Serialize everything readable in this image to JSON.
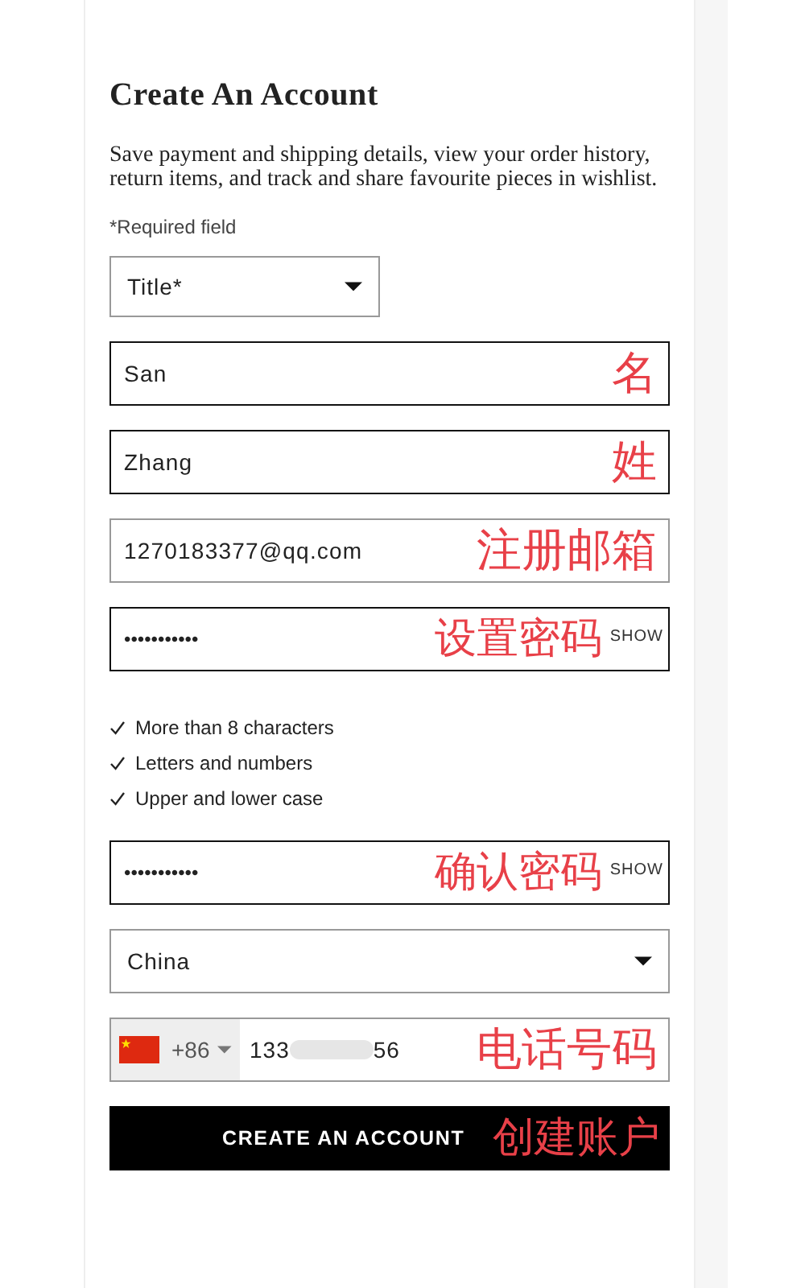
{
  "heading": "Create An Account",
  "intro": "Save payment and shipping details, view your order history, return items, and track and share favourite pieces in wishlist.",
  "required_note": "*Required field",
  "title_select": {
    "value": "Title*"
  },
  "fields": [
    {
      "kind": "text",
      "value": "San",
      "highlighted": true,
      "annotation": "名"
    },
    {
      "kind": "text",
      "value": "Zhang",
      "highlighted": true,
      "annotation": "姓"
    },
    {
      "kind": "text",
      "value": "1270183377@qq.com",
      "highlighted": false,
      "annotation": "注册邮箱"
    },
    {
      "kind": "password",
      "value": "•••••••••••",
      "toggle": "SHOW",
      "highlighted": true,
      "annotation": "设置密码"
    }
  ],
  "password_rules": [
    {
      "text": "More than 8 characters",
      "checked": true
    },
    {
      "text": "Letters and numbers",
      "checked": true
    },
    {
      "text": "Upper and lower case",
      "checked": true
    }
  ],
  "confirm_password": {
    "value": "•••••••••••",
    "toggle": "SHOW",
    "highlighted": true,
    "annotation": "确认密码"
  },
  "country_select": {
    "value": "China"
  },
  "phone": {
    "code": "+86",
    "number_start": "133",
    "number_end": "56",
    "annotation": "电话号码"
  },
  "submit": {
    "label": "CREATE AN ACCOUNT",
    "annotation": "创建账户"
  }
}
